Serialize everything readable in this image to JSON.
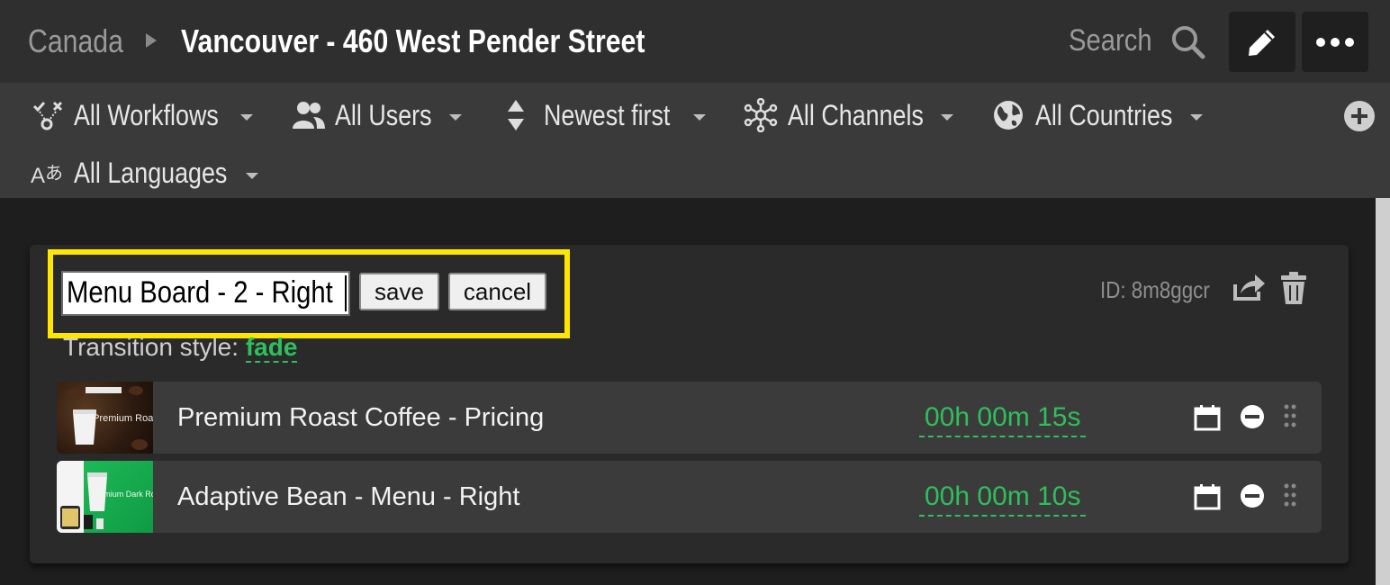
{
  "header": {
    "breadcrumb_root": "Canada",
    "breadcrumb_current": "Vancouver - 460 West Pender Street",
    "search_label": "Search",
    "icons": {
      "search": "search-icon",
      "edit": "pencil-icon",
      "more": "ellipsis-icon"
    }
  },
  "filters": {
    "workflows": "All Workflows",
    "users": "All Users",
    "sort": "Newest first",
    "channels": "All Channels",
    "countries": "All Countries",
    "languages": "All Languages"
  },
  "playlist": {
    "name_value": "Menu Board - 2 - Right",
    "save_label": "save",
    "cancel_label": "cancel",
    "transition_label": "Transition style:",
    "transition_value": "fade",
    "id_text": "ID:  8m8ggcr",
    "items": [
      {
        "title": "Premium Roast Coffee - Pricing",
        "duration": "00h 00m 15s",
        "thumb_text": "Premium Roast"
      },
      {
        "title": "Adaptive Bean - Menu - Right",
        "duration": "00h 00m 10s",
        "thumb_text": "Premium Dark Roast"
      }
    ]
  },
  "colors": {
    "accent_green": "#2fbf5b",
    "highlight_yellow": "#ffe600"
  }
}
